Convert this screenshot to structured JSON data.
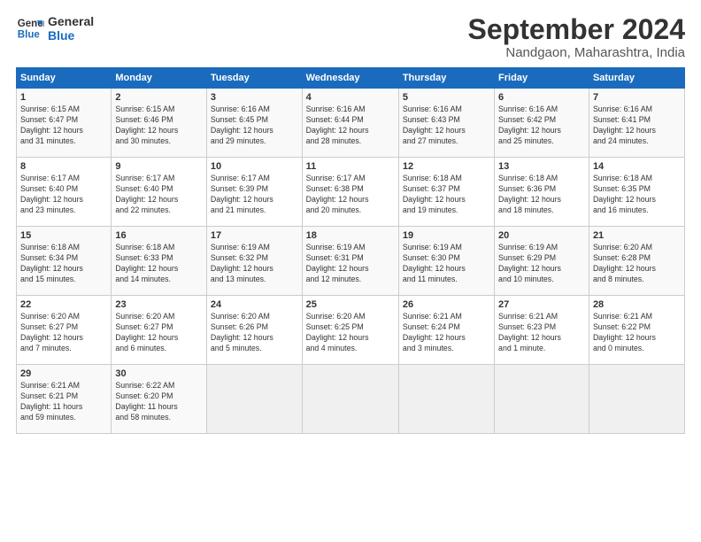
{
  "logo": {
    "line1": "General",
    "line2": "Blue"
  },
  "title": "September 2024",
  "subtitle": "Nandgaon, Maharashtra, India",
  "days_of_week": [
    "Sunday",
    "Monday",
    "Tuesday",
    "Wednesday",
    "Thursday",
    "Friday",
    "Saturday"
  ],
  "weeks": [
    [
      {
        "day": "1",
        "info": "Sunrise: 6:15 AM\nSunset: 6:47 PM\nDaylight: 12 hours\nand 31 minutes."
      },
      {
        "day": "2",
        "info": "Sunrise: 6:15 AM\nSunset: 6:46 PM\nDaylight: 12 hours\nand 30 minutes."
      },
      {
        "day": "3",
        "info": "Sunrise: 6:16 AM\nSunset: 6:45 PM\nDaylight: 12 hours\nand 29 minutes."
      },
      {
        "day": "4",
        "info": "Sunrise: 6:16 AM\nSunset: 6:44 PM\nDaylight: 12 hours\nand 28 minutes."
      },
      {
        "day": "5",
        "info": "Sunrise: 6:16 AM\nSunset: 6:43 PM\nDaylight: 12 hours\nand 27 minutes."
      },
      {
        "day": "6",
        "info": "Sunrise: 6:16 AM\nSunset: 6:42 PM\nDaylight: 12 hours\nand 25 minutes."
      },
      {
        "day": "7",
        "info": "Sunrise: 6:16 AM\nSunset: 6:41 PM\nDaylight: 12 hours\nand 24 minutes."
      }
    ],
    [
      {
        "day": "8",
        "info": "Sunrise: 6:17 AM\nSunset: 6:40 PM\nDaylight: 12 hours\nand 23 minutes."
      },
      {
        "day": "9",
        "info": "Sunrise: 6:17 AM\nSunset: 6:40 PM\nDaylight: 12 hours\nand 22 minutes."
      },
      {
        "day": "10",
        "info": "Sunrise: 6:17 AM\nSunset: 6:39 PM\nDaylight: 12 hours\nand 21 minutes."
      },
      {
        "day": "11",
        "info": "Sunrise: 6:17 AM\nSunset: 6:38 PM\nDaylight: 12 hours\nand 20 minutes."
      },
      {
        "day": "12",
        "info": "Sunrise: 6:18 AM\nSunset: 6:37 PM\nDaylight: 12 hours\nand 19 minutes."
      },
      {
        "day": "13",
        "info": "Sunrise: 6:18 AM\nSunset: 6:36 PM\nDaylight: 12 hours\nand 18 minutes."
      },
      {
        "day": "14",
        "info": "Sunrise: 6:18 AM\nSunset: 6:35 PM\nDaylight: 12 hours\nand 16 minutes."
      }
    ],
    [
      {
        "day": "15",
        "info": "Sunrise: 6:18 AM\nSunset: 6:34 PM\nDaylight: 12 hours\nand 15 minutes."
      },
      {
        "day": "16",
        "info": "Sunrise: 6:18 AM\nSunset: 6:33 PM\nDaylight: 12 hours\nand 14 minutes."
      },
      {
        "day": "17",
        "info": "Sunrise: 6:19 AM\nSunset: 6:32 PM\nDaylight: 12 hours\nand 13 minutes."
      },
      {
        "day": "18",
        "info": "Sunrise: 6:19 AM\nSunset: 6:31 PM\nDaylight: 12 hours\nand 12 minutes."
      },
      {
        "day": "19",
        "info": "Sunrise: 6:19 AM\nSunset: 6:30 PM\nDaylight: 12 hours\nand 11 minutes."
      },
      {
        "day": "20",
        "info": "Sunrise: 6:19 AM\nSunset: 6:29 PM\nDaylight: 12 hours\nand 10 minutes."
      },
      {
        "day": "21",
        "info": "Sunrise: 6:20 AM\nSunset: 6:28 PM\nDaylight: 12 hours\nand 8 minutes."
      }
    ],
    [
      {
        "day": "22",
        "info": "Sunrise: 6:20 AM\nSunset: 6:27 PM\nDaylight: 12 hours\nand 7 minutes."
      },
      {
        "day": "23",
        "info": "Sunrise: 6:20 AM\nSunset: 6:27 PM\nDaylight: 12 hours\nand 6 minutes."
      },
      {
        "day": "24",
        "info": "Sunrise: 6:20 AM\nSunset: 6:26 PM\nDaylight: 12 hours\nand 5 minutes."
      },
      {
        "day": "25",
        "info": "Sunrise: 6:20 AM\nSunset: 6:25 PM\nDaylight: 12 hours\nand 4 minutes."
      },
      {
        "day": "26",
        "info": "Sunrise: 6:21 AM\nSunset: 6:24 PM\nDaylight: 12 hours\nand 3 minutes."
      },
      {
        "day": "27",
        "info": "Sunrise: 6:21 AM\nSunset: 6:23 PM\nDaylight: 12 hours\nand 1 minute."
      },
      {
        "day": "28",
        "info": "Sunrise: 6:21 AM\nSunset: 6:22 PM\nDaylight: 12 hours\nand 0 minutes."
      }
    ],
    [
      {
        "day": "29",
        "info": "Sunrise: 6:21 AM\nSunset: 6:21 PM\nDaylight: 11 hours\nand 59 minutes."
      },
      {
        "day": "30",
        "info": "Sunrise: 6:22 AM\nSunset: 6:20 PM\nDaylight: 11 hours\nand 58 minutes."
      },
      {
        "day": "",
        "info": ""
      },
      {
        "day": "",
        "info": ""
      },
      {
        "day": "",
        "info": ""
      },
      {
        "day": "",
        "info": ""
      },
      {
        "day": "",
        "info": ""
      }
    ]
  ]
}
